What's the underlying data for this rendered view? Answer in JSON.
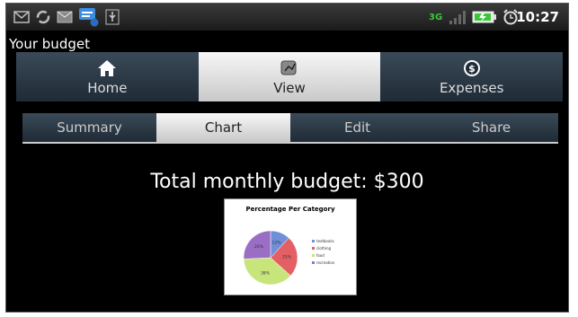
{
  "status_bar": {
    "time": "10:27",
    "network": "3G",
    "icons": [
      "mail-icon",
      "sync-icon",
      "email-icon",
      "chat-notification-icon",
      "usb-icon",
      "signal-icon",
      "battery-icon",
      "alarm-icon"
    ],
    "notification_count": "1"
  },
  "app": {
    "title": "Your budget"
  },
  "main_tabs": [
    {
      "label": "Home",
      "icon": "home-icon",
      "active": false
    },
    {
      "label": "View",
      "icon": "chart-icon",
      "active": true
    },
    {
      "label": "Expenses",
      "icon": "dollar-icon",
      "active": false
    }
  ],
  "sub_tabs": [
    {
      "label": "Summary",
      "active": false
    },
    {
      "label": "Chart",
      "active": true
    },
    {
      "label": "Edit",
      "active": false
    },
    {
      "label": "Share",
      "active": false
    }
  ],
  "summary": {
    "total_text": "Total monthly budget: $300"
  },
  "chart_data": {
    "type": "pie",
    "title": "Percentage Per Category",
    "categories": [
      "textbooks",
      "clothing",
      "food",
      "recreation"
    ],
    "values": [
      12,
      25,
      38,
      26
    ],
    "colors": [
      "#6f8fd8",
      "#e35f64",
      "#c7e57a",
      "#9a6ec4"
    ]
  }
}
